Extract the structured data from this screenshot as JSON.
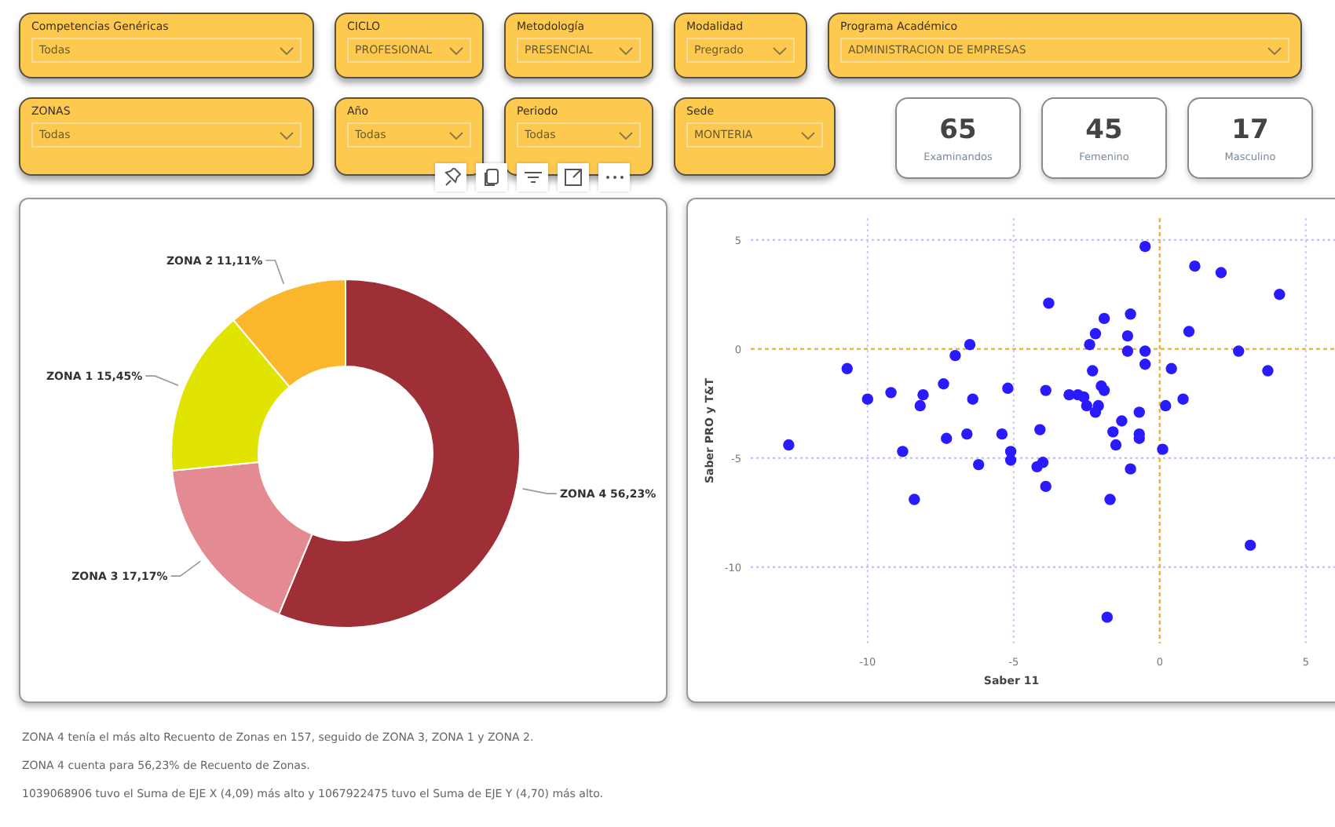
{
  "slicers_row_1": [
    {
      "label": "Competencias Genéricas",
      "value": "Todas"
    },
    {
      "label": "CICLO",
      "value": "PROFESIONAL"
    },
    {
      "label": "Metodología",
      "value": "PRESENCIAL"
    },
    {
      "label": "Modalidad",
      "value": "Pregrado"
    },
    {
      "label": "Programa Académico",
      "value": "ADMINISTRACION DE EMPRESAS"
    }
  ],
  "slicers_row_2": [
    {
      "label": "ZONAS",
      "value": "Todas"
    },
    {
      "label": "Año",
      "value": "Todas"
    },
    {
      "label": "Periodo",
      "value": "Todas"
    },
    {
      "label": "Sede",
      "value": "MONTERIA"
    }
  ],
  "cards": [
    {
      "value": "65",
      "label": "Examinandos"
    },
    {
      "value": "45",
      "label": "Femenino"
    },
    {
      "value": "17",
      "label": "Masculino"
    }
  ],
  "visual_header": [
    {
      "kind": "pin"
    },
    {
      "kind": "copy"
    },
    {
      "kind": "filter"
    },
    {
      "kind": "focus"
    },
    {
      "kind": "more"
    }
  ],
  "donut": {
    "chart_data": {
      "type": "donut",
      "categories": [
        "ZONA 4",
        "ZONA 3",
        "ZONA 1",
        "ZONA 2"
      ],
      "series": [
        {
          "values": [
            56.23,
            17.17,
            15.45,
            11.11
          ]
        }
      ],
      "colors": [
        "#9e2f37",
        "#e38a92",
        "#e1e400",
        "#fbb62c"
      ],
      "value_labels": [
        "56,23%",
        "17,17%",
        "15,45%",
        "11,11%"
      ]
    }
  },
  "scatter": {
    "chart_data": {
      "type": "scatter",
      "xlabel": "Saber 11",
      "ylabel": "Saber PRO y T&T",
      "xlim": [
        -14,
        6
      ],
      "ylim": [
        -13.5,
        6
      ],
      "xticks": [
        -10,
        -5,
        0,
        5
      ],
      "yticks": [
        5,
        0,
        -5,
        -10
      ],
      "grid": true,
      "x": [
        -12.7,
        -10.7,
        -10,
        -9.2,
        -8.8,
        -8.4,
        -8.2,
        -8.1,
        -7.4,
        -7.3,
        -7.0,
        -6.6,
        -6.5,
        -6.4,
        -6.2,
        -5.4,
        -5.2,
        -5.1,
        -5.1,
        -4.2,
        -4.1,
        -4.0,
        -3.9,
        -3.9,
        -3.8,
        -3.1,
        -2.8,
        -2.6,
        -2.5,
        -2.4,
        -2.3,
        -2.2,
        -2.2,
        -2.1,
        -2.0,
        -1.9,
        -1.9,
        -1.8,
        -1.7,
        -1.6,
        -1.5,
        -1.3,
        -1.1,
        -1.1,
        -1.0,
        -1.0,
        -0.7,
        -0.7,
        -0.7,
        -0.5,
        -0.5,
        -0.5,
        0.1,
        0.2,
        0.4,
        0.8,
        1.0,
        1.2,
        2.1,
        2.7,
        3.1,
        3.7,
        4.1
      ],
      "series": [
        {
          "color": "#2a1aff",
          "values": [
            -4.4,
            -0.9,
            -2.3,
            -2.0,
            -4.7,
            -6.9,
            -2.6,
            -2.1,
            -1.6,
            -4.1,
            -0.3,
            -3.9,
            0.2,
            -2.3,
            -5.3,
            -3.9,
            -1.8,
            -4.7,
            -5.1,
            -5.4,
            -3.7,
            -5.2,
            -1.9,
            -6.3,
            2.1,
            -2.1,
            -2.1,
            -2.2,
            -2.6,
            0.2,
            -1.0,
            0.7,
            -2.9,
            -2.6,
            -1.7,
            -1.9,
            1.4,
            -12.3,
            -6.9,
            -3.8,
            -4.4,
            -3.3,
            -0.1,
            0.6,
            -5.5,
            1.6,
            -3.9,
            -4.1,
            -2.9,
            -0.1,
            -0.7,
            4.7,
            -4.6,
            -2.6,
            -0.9,
            -2.3,
            0.8,
            3.8,
            3.5,
            -0.1,
            -9.0,
            -1.0,
            2.5
          ]
        }
      ]
    }
  },
  "narrative": [
    "ZONA 4 tenía el más alto Recuento de Zonas en 157, seguido de ZONA 3, ZONA 1 y ZONA 2.",
    "ZONA 4 cuenta para 56,23% de Recuento de Zonas.",
    "1039068906 tuvo el Suma de EJE X (4,09) más alto y 1067922475 tuvo el Suma de EJE Y (4,70) más alto."
  ]
}
